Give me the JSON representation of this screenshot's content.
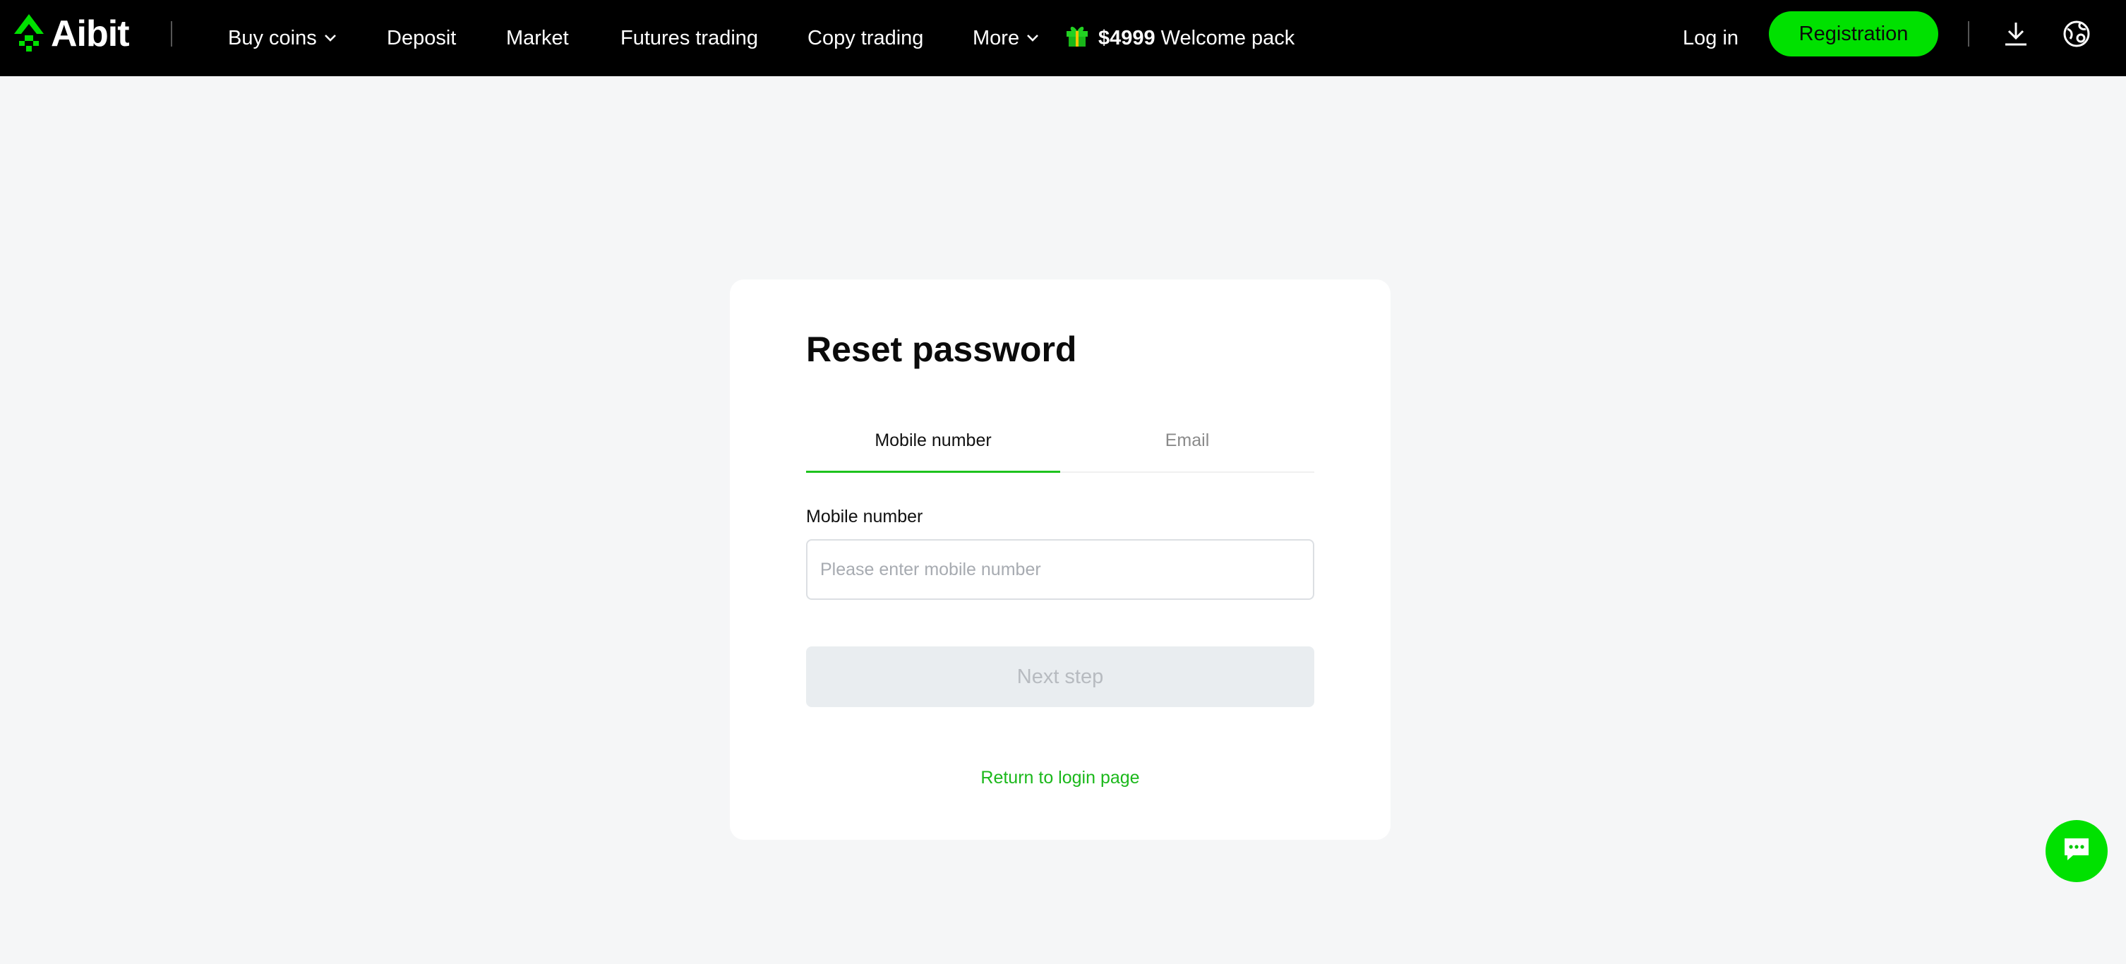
{
  "header": {
    "logo_text": "Aibit",
    "nav": {
      "buy_coins": "Buy coins",
      "deposit": "Deposit",
      "market": "Market",
      "futures_trading": "Futures trading",
      "copy_trading": "Copy trading",
      "more": "More"
    },
    "promo": {
      "amount": "$4999",
      "text": "Welcome pack"
    },
    "login": "Log in",
    "registration": "Registration"
  },
  "reset_card": {
    "title": "Reset password",
    "tabs": [
      {
        "label": "Mobile number",
        "active": true
      },
      {
        "label": "Email",
        "active": false
      }
    ],
    "field_label": "Mobile number",
    "input": {
      "value": "",
      "placeholder": "Please enter mobile number"
    },
    "next_button": "Next step",
    "return_link": "Return to login page"
  },
  "colors": {
    "brand_green": "#00e100",
    "link_green": "#1bb81b",
    "header_bg": "#000000",
    "page_bg": "#f5f6f7"
  },
  "icons": [
    "logo-mark-icon",
    "chevron-down-icon",
    "gift-icon",
    "download-icon",
    "language-globe-icon",
    "chat-icon"
  ]
}
